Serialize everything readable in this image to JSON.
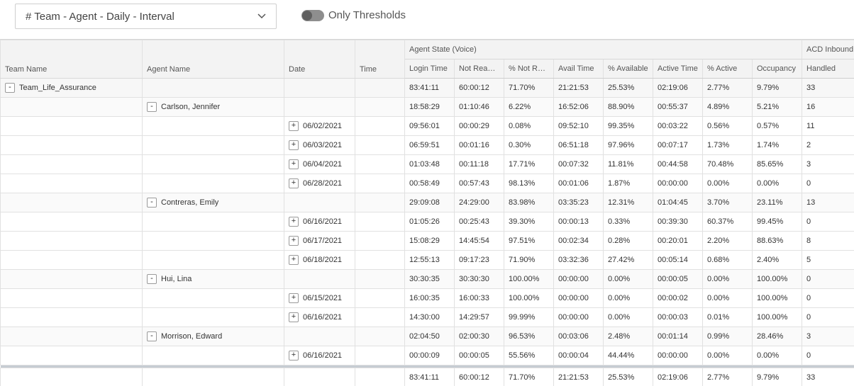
{
  "toolbar": {
    "report_select": "# Team - Agent - Daily - Interval",
    "threshold_toggle_label": "Only Thresholds"
  },
  "grid": {
    "group_headers": {
      "agent_state": "Agent State (Voice)",
      "acd_inbound": "ACD Inbound"
    },
    "columns": {
      "team_name": "Team Name",
      "agent_name": "Agent Name",
      "date": "Date",
      "time": "Time",
      "login_time": "Login Time",
      "not_ready": "Not Ready...",
      "pct_not_ready": "% Not Rea...",
      "avail_time": "Avail Time",
      "pct_available": "% Available",
      "active_time": "Active Time",
      "pct_active": "% Active",
      "occupancy": "Occupancy",
      "handled": "Handled"
    },
    "rows": [
      {
        "level": "team",
        "expander": "-",
        "team": "Team_Life_Assurance",
        "agent": "",
        "date": "",
        "time": "",
        "login": "83:41:11",
        "not_ready": "60:00:12",
        "pct_not_ready": "71.70%",
        "avail": "21:21:53",
        "pct_avail": "25.53%",
        "active": "02:19:06",
        "pct_active": "2.77%",
        "occupancy": "9.79%",
        "handled": "33"
      },
      {
        "level": "agent",
        "expander": "-",
        "team": "",
        "agent": "Carlson, Jennifer",
        "date": "",
        "time": "",
        "login": "18:58:29",
        "not_ready": "01:10:46",
        "pct_not_ready": "6.22%",
        "avail": "16:52:06",
        "pct_avail": "88.90%",
        "active": "00:55:37",
        "pct_active": "4.89%",
        "occupancy": "5.21%",
        "handled": "16"
      },
      {
        "level": "date",
        "expander": "+",
        "team": "",
        "agent": "",
        "date": "06/02/2021",
        "time": "",
        "login": "09:56:01",
        "not_ready": "00:00:29",
        "pct_not_ready": "0.08%",
        "avail": "09:52:10",
        "pct_avail": "99.35%",
        "active": "00:03:22",
        "pct_active": "0.56%",
        "occupancy": "0.57%",
        "handled": "11"
      },
      {
        "level": "date",
        "expander": "+",
        "team": "",
        "agent": "",
        "date": "06/03/2021",
        "time": "",
        "login": "06:59:51",
        "not_ready": "00:01:16",
        "pct_not_ready": "0.30%",
        "avail": "06:51:18",
        "pct_avail": "97.96%",
        "active": "00:07:17",
        "pct_active": "1.73%",
        "occupancy": "1.74%",
        "handled": "2"
      },
      {
        "level": "date",
        "expander": "+",
        "team": "",
        "agent": "",
        "date": "06/04/2021",
        "time": "",
        "login": "01:03:48",
        "not_ready": "00:11:18",
        "pct_not_ready": "17.71%",
        "avail": "00:07:32",
        "pct_avail": "11.81%",
        "active": "00:44:58",
        "pct_active": "70.48%",
        "occupancy": "85.65%",
        "handled": "3"
      },
      {
        "level": "date",
        "expander": "+",
        "team": "",
        "agent": "",
        "date": "06/28/2021",
        "time": "",
        "login": "00:58:49",
        "not_ready": "00:57:43",
        "pct_not_ready": "98.13%",
        "avail": "00:01:06",
        "pct_avail": "1.87%",
        "active": "00:00:00",
        "pct_active": "0.00%",
        "occupancy": "0.00%",
        "handled": "0"
      },
      {
        "level": "agent",
        "expander": "-",
        "team": "",
        "agent": "Contreras, Emily",
        "date": "",
        "time": "",
        "login": "29:09:08",
        "not_ready": "24:29:00",
        "pct_not_ready": "83.98%",
        "avail": "03:35:23",
        "pct_avail": "12.31%",
        "active": "01:04:45",
        "pct_active": "3.70%",
        "occupancy": "23.11%",
        "handled": "13"
      },
      {
        "level": "date",
        "expander": "+",
        "team": "",
        "agent": "",
        "date": "06/16/2021",
        "time": "",
        "login": "01:05:26",
        "not_ready": "00:25:43",
        "pct_not_ready": "39.30%",
        "avail": "00:00:13",
        "pct_avail": "0.33%",
        "active": "00:39:30",
        "pct_active": "60.37%",
        "occupancy": "99.45%",
        "handled": "0"
      },
      {
        "level": "date",
        "expander": "+",
        "team": "",
        "agent": "",
        "date": "06/17/2021",
        "time": "",
        "login": "15:08:29",
        "not_ready": "14:45:54",
        "pct_not_ready": "97.51%",
        "avail": "00:02:34",
        "pct_avail": "0.28%",
        "active": "00:20:01",
        "pct_active": "2.20%",
        "occupancy": "88.63%",
        "handled": "8"
      },
      {
        "level": "date",
        "expander": "+",
        "team": "",
        "agent": "",
        "date": "06/18/2021",
        "time": "",
        "login": "12:55:13",
        "not_ready": "09:17:23",
        "pct_not_ready": "71.90%",
        "avail": "03:32:36",
        "pct_avail": "27.42%",
        "active": "00:05:14",
        "pct_active": "0.68%",
        "occupancy": "2.40%",
        "handled": "5"
      },
      {
        "level": "agent",
        "expander": "-",
        "team": "",
        "agent": "Hui, Lina",
        "date": "",
        "time": "",
        "login": "30:30:35",
        "not_ready": "30:30:30",
        "pct_not_ready": "100.00%",
        "avail": "00:00:00",
        "pct_avail": "0.00%",
        "active": "00:00:05",
        "pct_active": "0.00%",
        "occupancy": "100.00%",
        "handled": "0"
      },
      {
        "level": "date",
        "expander": "+",
        "team": "",
        "agent": "",
        "date": "06/15/2021",
        "time": "",
        "login": "16:00:35",
        "not_ready": "16:00:33",
        "pct_not_ready": "100.00%",
        "avail": "00:00:00",
        "pct_avail": "0.00%",
        "active": "00:00:02",
        "pct_active": "0.00%",
        "occupancy": "100.00%",
        "handled": "0"
      },
      {
        "level": "date",
        "expander": "+",
        "team": "",
        "agent": "",
        "date": "06/16/2021",
        "time": "",
        "login": "14:30:00",
        "not_ready": "14:29:57",
        "pct_not_ready": "99.99%",
        "avail": "00:00:00",
        "pct_avail": "0.00%",
        "active": "00:00:03",
        "pct_active": "0.01%",
        "occupancy": "100.00%",
        "handled": "0"
      },
      {
        "level": "agent",
        "expander": "-",
        "team": "",
        "agent": "Morrison, Edward",
        "date": "",
        "time": "",
        "login": "02:04:50",
        "not_ready": "02:00:30",
        "pct_not_ready": "96.53%",
        "avail": "00:03:06",
        "pct_avail": "2.48%",
        "active": "00:01:14",
        "pct_active": "0.99%",
        "occupancy": "28.46%",
        "handled": "3"
      },
      {
        "level": "date",
        "expander": "+",
        "team": "",
        "agent": "",
        "date": "06/16/2021",
        "time": "",
        "login": "00:00:09",
        "not_ready": "00:00:05",
        "pct_not_ready": "55.56%",
        "avail": "00:00:04",
        "pct_avail": "44.44%",
        "active": "00:00:00",
        "pct_active": "0.00%",
        "occupancy": "0.00%",
        "handled": "0"
      }
    ],
    "totals": {
      "login": "83:41:11",
      "not_ready": "60:00:12",
      "pct_not_ready": "71.70%",
      "avail": "21:21:53",
      "pct_avail": "25.53%",
      "active": "02:19:06",
      "pct_active": "2.77%",
      "occupancy": "9.79%",
      "handled": "33"
    }
  },
  "colors": {
    "header_bg": "#f3f3f3",
    "grid_line": "#e1e1e1",
    "separator": "#c6ccd2",
    "toggle_off": "#8e8e8e"
  }
}
